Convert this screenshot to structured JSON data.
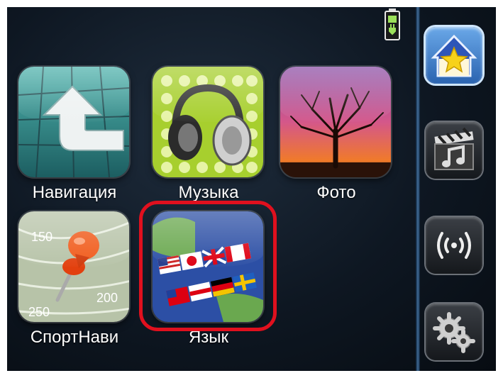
{
  "apps": [
    {
      "id": "navigation",
      "label": "Навигация",
      "icon": "navigation-arrow-icon"
    },
    {
      "id": "music",
      "label": "Музыка",
      "icon": "headphones-icon"
    },
    {
      "id": "photo",
      "label": "Фото",
      "icon": "tree-sunset-icon"
    },
    {
      "id": "sportnavi",
      "label": "СпортНави",
      "icon": "map-pin-contour-icon",
      "contour_values": [
        "150",
        "200",
        "250"
      ]
    },
    {
      "id": "language",
      "label": "Язык",
      "icon": "flags-globe-icon",
      "highlighted": true
    }
  ],
  "sidebar": [
    {
      "id": "home",
      "icon": "home-star-icon",
      "active": true
    },
    {
      "id": "media",
      "icon": "clapper-music-icon",
      "active": false
    },
    {
      "id": "wireless",
      "icon": "wireless-signal-icon",
      "active": false
    },
    {
      "id": "settings",
      "icon": "gears-icon",
      "active": false
    }
  ],
  "status": {
    "battery_icon": "battery-charging-icon"
  },
  "colors": {
    "highlight": "#e0101e",
    "active_button": "#2a63b0",
    "background": "#0e1722"
  }
}
